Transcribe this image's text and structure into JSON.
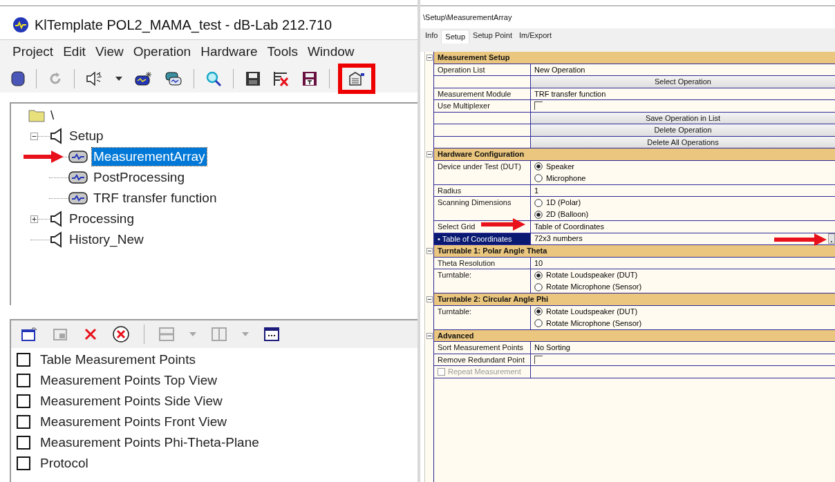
{
  "window": {
    "title": "KlTemplate POL2_MAMA_test - dB-Lab 212.710"
  },
  "menu": [
    "Project",
    "Edit",
    "View",
    "Operation",
    "Hardware",
    "Tools",
    "Window"
  ],
  "toolbar": [
    {
      "kind": "database",
      "disabled": false,
      "highlighted": false
    },
    {
      "kind": "separator"
    },
    {
      "kind": "refresh",
      "disabled": true,
      "highlighted": false
    },
    {
      "kind": "separator"
    },
    {
      "kind": "speaker",
      "disabled": false,
      "highlighted": false
    },
    {
      "kind": "dropdown",
      "disabled": false,
      "highlighted": false
    },
    {
      "kind": "module-new",
      "disabled": false,
      "highlighted": false
    },
    {
      "kind": "module-swap",
      "disabled": false,
      "highlighted": false
    },
    {
      "kind": "separator"
    },
    {
      "kind": "search",
      "disabled": false,
      "highlighted": false
    },
    {
      "kind": "separator"
    },
    {
      "kind": "save",
      "disabled": false,
      "highlighted": false
    },
    {
      "kind": "delete-list",
      "disabled": false,
      "highlighted": false
    },
    {
      "kind": "save-template",
      "disabled": false,
      "highlighted": false
    },
    {
      "kind": "separator"
    },
    {
      "kind": "properties",
      "disabled": false,
      "highlighted": true
    }
  ],
  "tree": [
    {
      "label": "\\",
      "kind": "folder",
      "selected": false,
      "children": [
        {
          "label": "Setup",
          "kind": "group",
          "expanded": true,
          "selected": false,
          "children": [
            {
              "label": "MeasurementArray",
              "kind": "module",
              "selected": true,
              "pointed": true
            },
            {
              "label": "PostProcessing",
              "kind": "module",
              "selected": false
            },
            {
              "label": "TRF transfer function",
              "kind": "module",
              "selected": false
            }
          ]
        },
        {
          "label": "Processing",
          "kind": "group",
          "expanded": false,
          "selected": false
        },
        {
          "label": "History_New",
          "kind": "group",
          "selected": false
        }
      ]
    }
  ],
  "view_toolbar": [
    {
      "kind": "window-new",
      "disabled": false
    },
    {
      "kind": "window-small",
      "disabled": true
    },
    {
      "kind": "close",
      "disabled": false
    },
    {
      "kind": "close-all",
      "disabled": false
    },
    {
      "kind": "separator"
    },
    {
      "kind": "rows",
      "disabled": true
    },
    {
      "kind": "dropdown",
      "disabled": true
    },
    {
      "kind": "columns",
      "disabled": true
    },
    {
      "kind": "dropdown",
      "disabled": true
    },
    {
      "kind": "window-dots",
      "disabled": false
    }
  ],
  "views": [
    {
      "label": "Table Measurement Points",
      "checked": false
    },
    {
      "label": "Measurement Points Top View",
      "checked": false
    },
    {
      "label": "Measurement Points Side View",
      "checked": false
    },
    {
      "label": "Measurement Points Front View",
      "checked": false
    },
    {
      "label": "Measurement Points Phi-Theta-Plane",
      "checked": false
    },
    {
      "label": "Protocol",
      "checked": false
    }
  ],
  "path": "\\Setup\\MeasurementArray",
  "tabs": [
    {
      "label": "Info",
      "selected": false
    },
    {
      "label": "Setup",
      "selected": true
    },
    {
      "label": "Setup Point",
      "selected": false
    },
    {
      "label": "Im/Export",
      "selected": false
    }
  ],
  "sections": [
    {
      "title": "Measurement Setup",
      "expanded": true,
      "rows": [
        {
          "kind": "text",
          "label": "Operation List",
          "value": "New Operation",
          "selected": false
        },
        {
          "kind": "button",
          "value": "Select Operation",
          "selected": false
        },
        {
          "kind": "text",
          "label": "Measurement Module",
          "value": "TRF transfer function",
          "selected": false
        },
        {
          "kind": "checkbox",
          "label": "Use Multiplexer",
          "checked": false,
          "selected": false
        },
        {
          "kind": "button",
          "value": "Save Operation in List",
          "selected": false
        },
        {
          "kind": "button",
          "value": "Delete Operation",
          "selected": false
        },
        {
          "kind": "button",
          "value": "Delete All Operations",
          "selected": false
        }
      ]
    },
    {
      "title": "Hardware Configuration",
      "expanded": true,
      "rows": [
        {
          "kind": "radio",
          "label": "Device under Test (DUT)",
          "selected": false,
          "options": [
            {
              "label": "Speaker",
              "selected": true
            },
            {
              "label": "Microphone",
              "selected": false
            }
          ]
        },
        {
          "kind": "text",
          "label": "Radius",
          "value": "1",
          "selected": false
        },
        {
          "kind": "radio",
          "label": "Scanning Dimensions",
          "selected": false,
          "options": [
            {
              "label": "1D (Polar)",
              "selected": false
            },
            {
              "label": "2D (Balloon)",
              "selected": true
            }
          ]
        },
        {
          "kind": "text",
          "label": "Select Grid",
          "value": "Table of Coordinates",
          "selected": false,
          "pointed": true
        },
        {
          "kind": "browse",
          "label": "• Table of Coordinates",
          "value": "72x3 numbers",
          "selected": true,
          "pointed": true
        }
      ]
    },
    {
      "title": "Turntable 1: Polar Angle Theta",
      "expanded": true,
      "rows": [
        {
          "kind": "text",
          "label": "Theta Resolution",
          "value": "10",
          "selected": false
        },
        {
          "kind": "radio",
          "label": "Turntable:",
          "selected": false,
          "options": [
            {
              "label": "Rotate Loudspeaker (DUT)",
              "selected": true
            },
            {
              "label": "Rotate Microphone (Sensor)",
              "selected": false
            }
          ]
        }
      ]
    },
    {
      "title": "Turntable 2: Circular Angle Phi",
      "expanded": true,
      "rows": [
        {
          "kind": "radio",
          "label": "Turntable:",
          "selected": false,
          "options": [
            {
              "label": "Rotate Loudspeaker (DUT)",
              "selected": true
            },
            {
              "label": "Rotate Microphone (Sensor)",
              "selected": false
            }
          ]
        }
      ]
    },
    {
      "title": "Advanced",
      "expanded": true,
      "rows": [
        {
          "kind": "text",
          "label": "Sort Measurement Points",
          "value": "No Sorting",
          "selected": false
        },
        {
          "kind": "checkbox",
          "label": "Remove Redundant Point",
          "checked": false,
          "selected": false
        },
        {
          "kind": "label-checkbox",
          "label": "Repeat Measurement",
          "checked": false,
          "disabled": true,
          "selected": false
        }
      ]
    }
  ]
}
